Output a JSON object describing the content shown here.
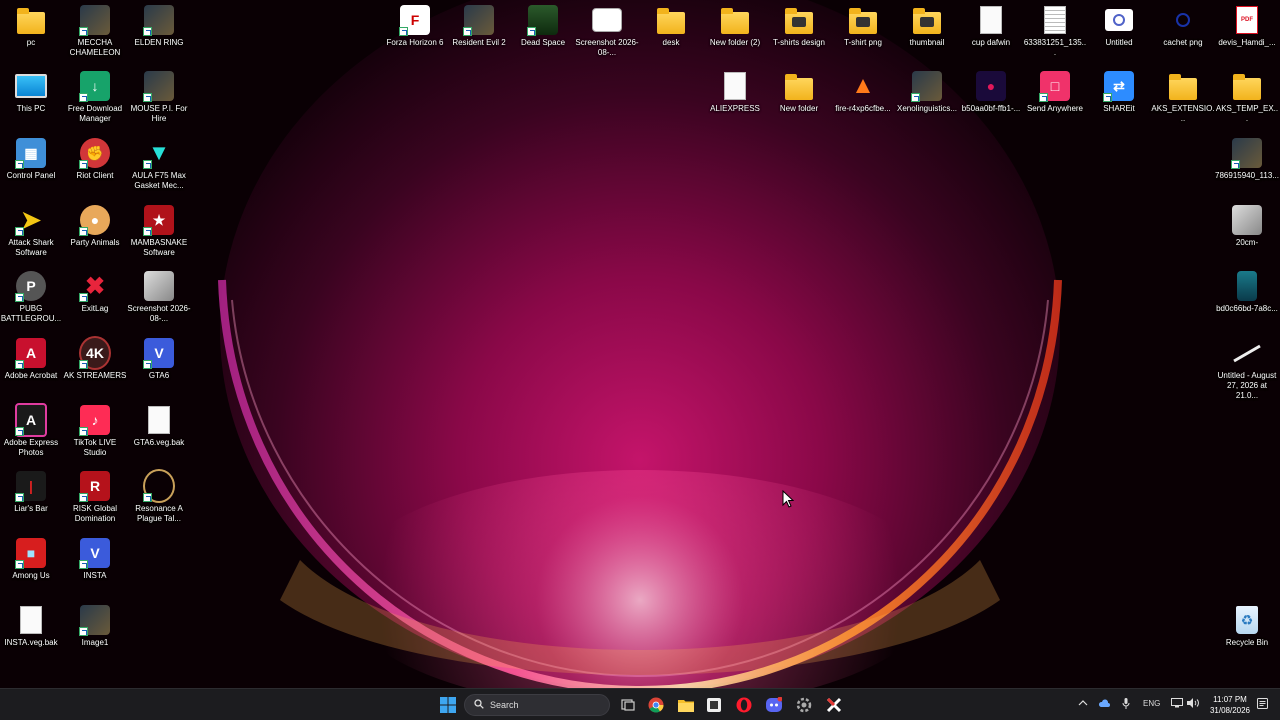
{
  "desktop": {
    "icons": [
      {
        "label": "pc",
        "kind": "folder"
      },
      {
        "label": "MECCHA CHAMELEON",
        "kind": "image"
      },
      {
        "label": "ELDEN RING",
        "kind": "image"
      },
      {
        "label": "This PC",
        "kind": "monitor"
      },
      {
        "label": "Free Download Manager",
        "kind": "fdm"
      },
      {
        "label": "MOUSE P.I. For Hire",
        "kind": "image"
      },
      {
        "label": "Control Panel",
        "kind": "control"
      },
      {
        "label": "Riot Client",
        "kind": "riot"
      },
      {
        "label": "AULA F75 Max Gasket Mec...",
        "kind": "aula"
      },
      {
        "label": "Attack Shark Software",
        "kind": "shark"
      },
      {
        "label": "Party Animals",
        "kind": "dog"
      },
      {
        "label": "MAMBASNAKE Software",
        "kind": "snake"
      },
      {
        "label": "PUBG BATTLEGROU...",
        "kind": "pubg"
      },
      {
        "label": "ExitLag",
        "kind": "exitlag"
      },
      {
        "label": "Screenshot 2026-08-...",
        "kind": "thumb"
      },
      {
        "label": "Adobe Acrobat",
        "kind": "acrobat"
      },
      {
        "label": "AK STREAMERS",
        "kind": "ak"
      },
      {
        "label": "GTA6",
        "kind": "v"
      },
      {
        "label": "Adobe Express Photos",
        "kind": "express"
      },
      {
        "label": "TikTok LIVE Studio",
        "kind": "tiktok"
      },
      {
        "label": "GTA6.veg.bak",
        "kind": "doc"
      },
      {
        "label": "Liar's Bar",
        "kind": "liars"
      },
      {
        "label": "RISK Global Domination",
        "kind": "risk"
      },
      {
        "label": "Resonance A Plague Tal...",
        "kind": "resonance"
      },
      {
        "label": "Among Us",
        "kind": "amongus"
      },
      {
        "label": "INSTA",
        "kind": "v"
      },
      {
        "label": "INSTA.veg.bak",
        "kind": "doc"
      },
      {
        "label": "Image1",
        "kind": "image"
      },
      {
        "label": "Forza Horizon 6",
        "kind": "forza"
      },
      {
        "label": "Resident Evil 2",
        "kind": "image"
      },
      {
        "label": "Dead Space",
        "kind": "deadspace"
      },
      {
        "label": "Screenshot 2026-08-...",
        "kind": "whitethumb"
      },
      {
        "label": "desk",
        "kind": "folder"
      },
      {
        "label": "New folder (2)",
        "kind": "folder"
      },
      {
        "label": "T-shirts design",
        "kind": "folderimg"
      },
      {
        "label": "T-shirt png",
        "kind": "folderimg"
      },
      {
        "label": "thumbnail",
        "kind": "folderimg"
      },
      {
        "label": "cup dafwin",
        "kind": "doc"
      },
      {
        "label": "633831251_135...",
        "kind": "paper"
      },
      {
        "label": "Untitled",
        "kind": "untitled"
      },
      {
        "label": "cachet png",
        "kind": "cachet"
      },
      {
        "label": "devis_Hamdi_...",
        "kind": "pdf"
      },
      {
        "label": "ALIEXPRESS",
        "kind": "doc"
      },
      {
        "label": "New folder",
        "kind": "folder"
      },
      {
        "label": "fire-r4xp6cfbe...",
        "kind": "fire"
      },
      {
        "label": "Xenolinguistics...",
        "kind": "image"
      },
      {
        "label": "b50aa0bf-ffb1-...",
        "kind": "skull"
      },
      {
        "label": "Send Anywhere",
        "kind": "sendanywhere"
      },
      {
        "label": "SHAREit",
        "kind": "shareit"
      },
      {
        "label": "AKS_EXTENSIO...",
        "kind": "folder"
      },
      {
        "label": "AKS_TEMP_EX...",
        "kind": "folder"
      },
      {
        "label": "786915940_113...",
        "kind": "image"
      },
      {
        "label": "20cm-",
        "kind": "thumb"
      },
      {
        "label": "bd0c66bd-7a8c...",
        "kind": "bottle"
      },
      {
        "label": "Untitled - August 27, 2026 at 21.0...",
        "kind": "pen"
      },
      {
        "label": "Recycle Bin",
        "kind": "recycle"
      }
    ]
  },
  "taskbar": {
    "search_placeholder": "Search",
    "apps": [
      "start-icon",
      "task-view-icon",
      "chrome-icon",
      "file-explorer-icon",
      "app-icon",
      "opera-icon",
      "discord-icon",
      "settings-icon",
      "app-x-icon"
    ],
    "language": "ENG",
    "time": "11:07 PM",
    "date": "31/08/2026"
  },
  "colors": {
    "taskbar": "#1c1c1f",
    "accent": "#0078d4"
  }
}
